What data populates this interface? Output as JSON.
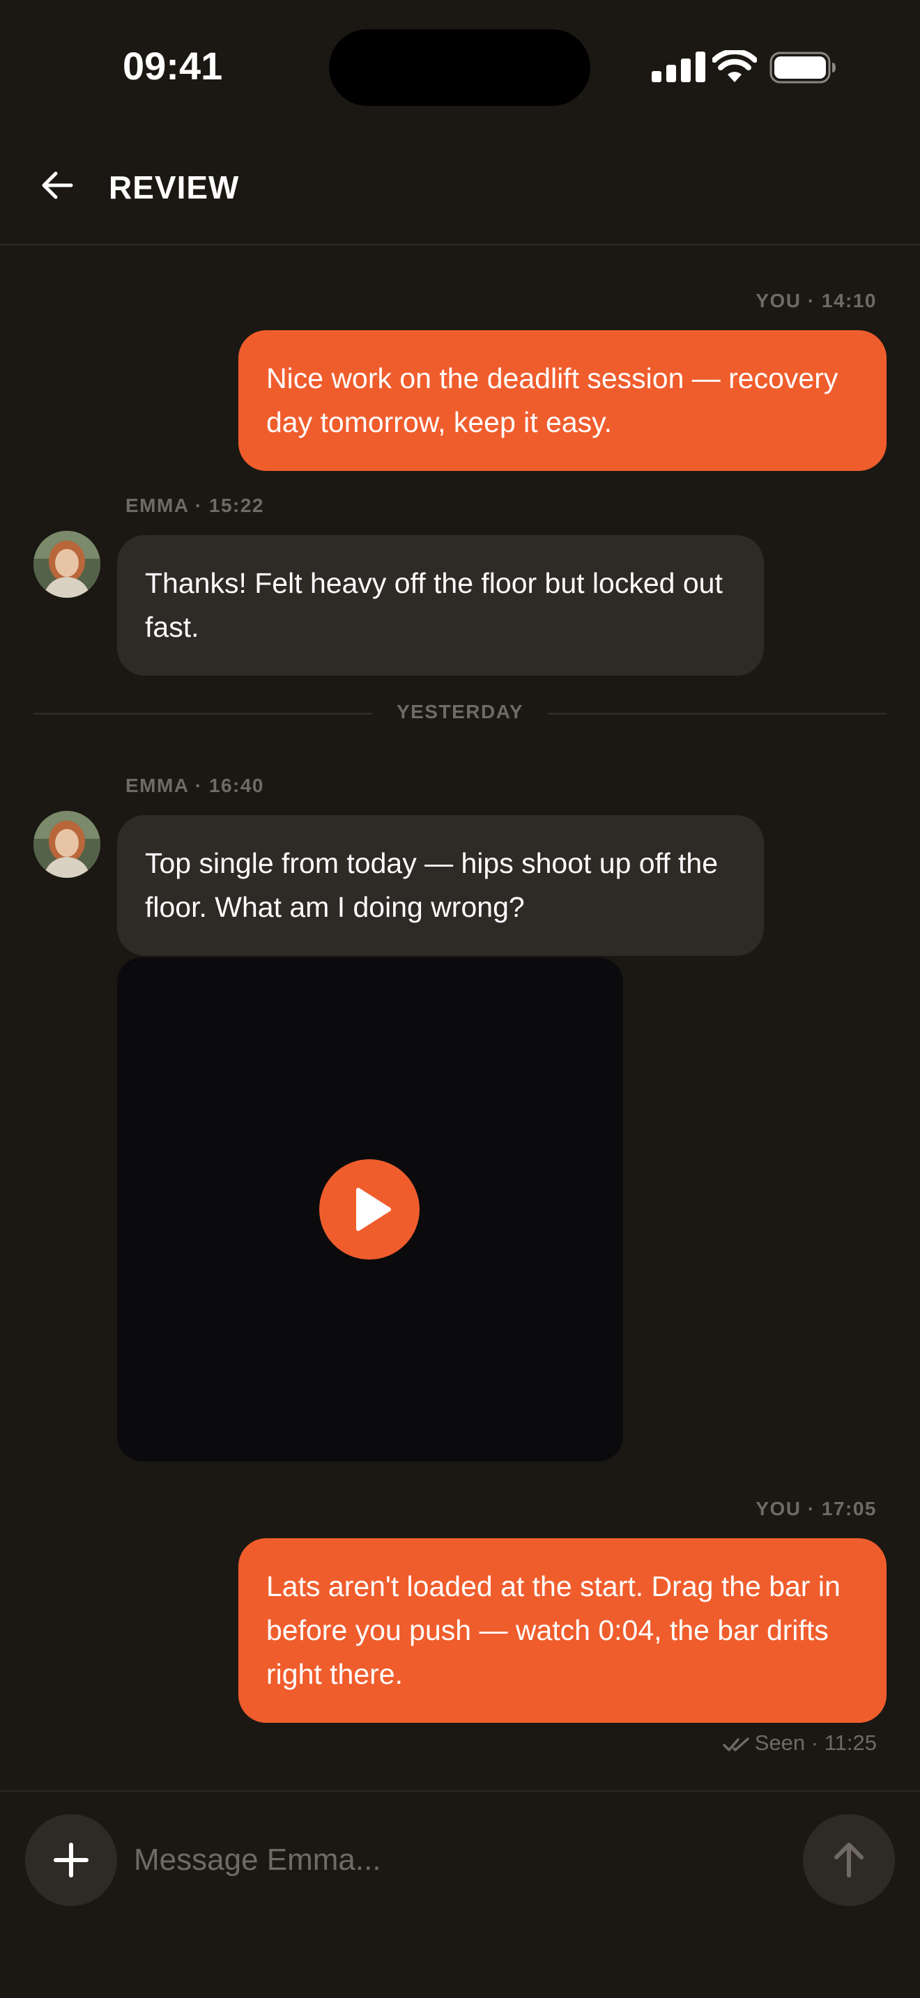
{
  "status": {
    "time": "09:41"
  },
  "header": {
    "title": "REVIEW"
  },
  "messages": [
    {
      "meta": "YOU · 14:10",
      "text": "Nice work on the deadlift session — recovery day tomorrow, keep it easy."
    },
    {
      "meta": "EMMA · 15:22",
      "text": "Thanks! Felt heavy off the floor but locked out fast."
    },
    {
      "meta": "EMMA · 16:40",
      "text": "Top single from today — hips shoot up off the floor. What am I doing wrong?"
    },
    {
      "meta": "YOU · 17:05",
      "text": "Lats aren't loaded at the start. Drag the bar in before you push — watch 0:04, the bar drifts right there."
    }
  ],
  "divider": {
    "label": "YESTERDAY"
  },
  "seen": {
    "text": "Seen · 11:25"
  },
  "composer": {
    "placeholder": "Message Emma..."
  },
  "colors": {
    "accent": "#f05d2d",
    "background": "#1b1814",
    "bubble_theirs": "#2e2b26",
    "muted": "#6f6a63"
  },
  "icons": [
    "back-arrow-icon",
    "signal-icon",
    "wifi-icon",
    "battery-icon",
    "play-icon",
    "double-check-icon",
    "plus-icon",
    "send-arrow-icon"
  ]
}
